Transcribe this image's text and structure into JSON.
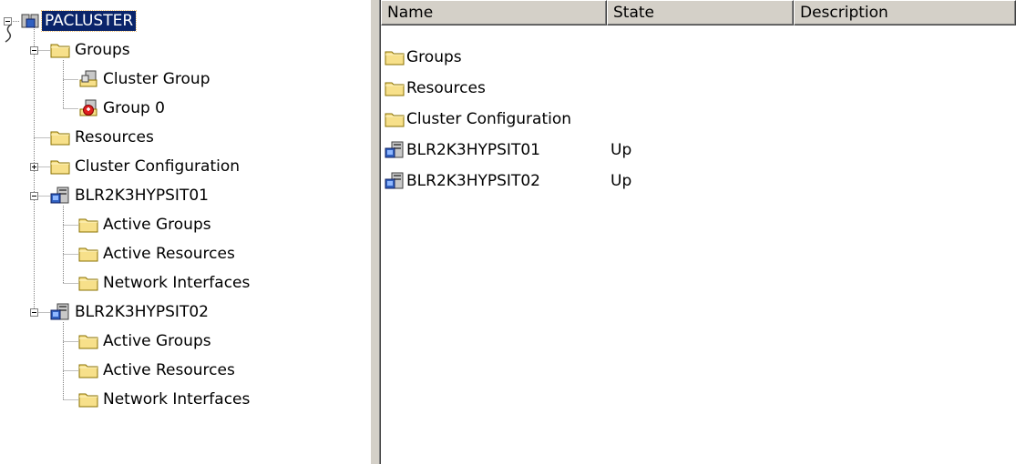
{
  "tree": {
    "root": {
      "label": "PACLUSTER",
      "icon": "cluster-icon"
    },
    "groups": {
      "label": "Groups",
      "icon": "folder-icon",
      "children": [
        {
          "label": "Cluster Group",
          "icon": "group-online-icon"
        },
        {
          "label": "Group 0",
          "icon": "group-failed-icon"
        }
      ]
    },
    "resources": {
      "label": "Resources",
      "icon": "folder-icon"
    },
    "cluster_configuration": {
      "label": "Cluster Configuration",
      "icon": "folder-icon"
    },
    "nodes": [
      {
        "label": "BLR2K3HYPSIT01",
        "icon": "server-icon",
        "children": [
          {
            "label": "Active Groups"
          },
          {
            "label": "Active Resources"
          },
          {
            "label": "Network Interfaces"
          }
        ]
      },
      {
        "label": "BLR2K3HYPSIT02",
        "icon": "server-icon",
        "children": [
          {
            "label": "Active Groups"
          },
          {
            "label": "Active Resources"
          },
          {
            "label": "Network Interfaces"
          }
        ]
      }
    ]
  },
  "list": {
    "columns": [
      "Name",
      "State",
      "Description"
    ],
    "rows": [
      {
        "name": "Groups",
        "state": "",
        "description": "",
        "icon": "folder-icon"
      },
      {
        "name": "Resources",
        "state": "",
        "description": "",
        "icon": "folder-icon"
      },
      {
        "name": "Cluster Configuration",
        "state": "",
        "description": "",
        "icon": "folder-icon"
      },
      {
        "name": "BLR2K3HYPSIT01",
        "state": "Up",
        "description": "",
        "icon": "server-icon"
      },
      {
        "name": "BLR2K3HYPSIT02",
        "state": "Up",
        "description": "",
        "icon": "server-icon"
      }
    ]
  },
  "colors": {
    "selection": "#0a246a",
    "folder": "#f7e08a",
    "panel": "#d4d0c8"
  }
}
